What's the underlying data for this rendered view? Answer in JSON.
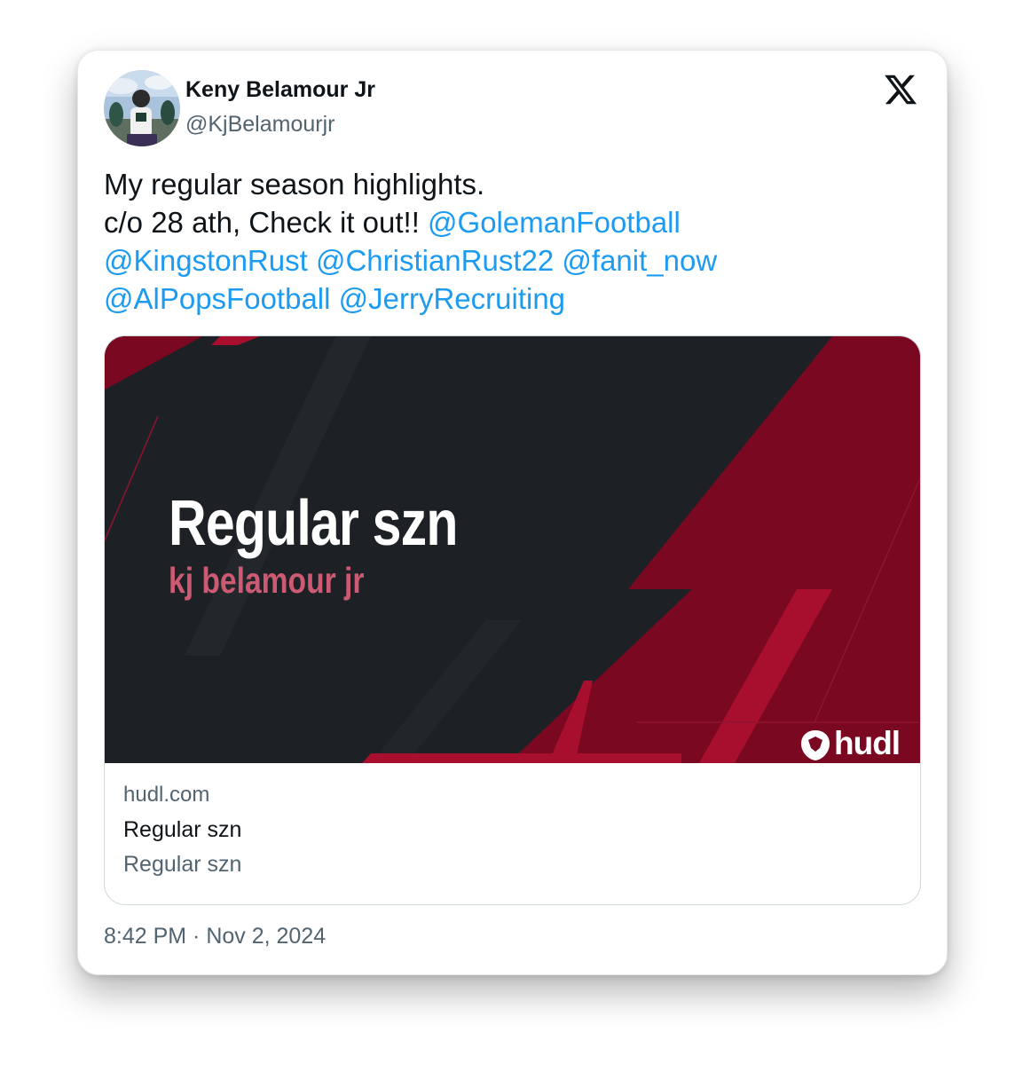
{
  "author": {
    "name": "Keny Belamour Jr",
    "handle": "@KjBelamourjr"
  },
  "icons": {
    "platform": "x-logo-icon",
    "avatar": "avatar-photo"
  },
  "tweet": {
    "line1": "My regular season highlights.",
    "line2_text": "c/o 28 ath, Check it out!! ",
    "mentions": [
      "@GolemanFootball",
      "@KingstonRust",
      "@ChristianRust22",
      "@fanit_now",
      "@AlPopsFootball",
      "@JerryRecruiting"
    ]
  },
  "media": {
    "video_title": "Regular szn",
    "video_subtitle": "kj belamour jr",
    "brand": "hudl"
  },
  "link_card": {
    "domain": "hudl.com",
    "title": "Regular szn",
    "description": "Regular szn"
  },
  "timestamp": "8:42 PM · Nov 2, 2024",
  "colors": {
    "mention": "#1d9bf0",
    "media_dark": "#1d2024",
    "media_red": "#7a0820",
    "subtitle_pink": "#cc5a72"
  }
}
